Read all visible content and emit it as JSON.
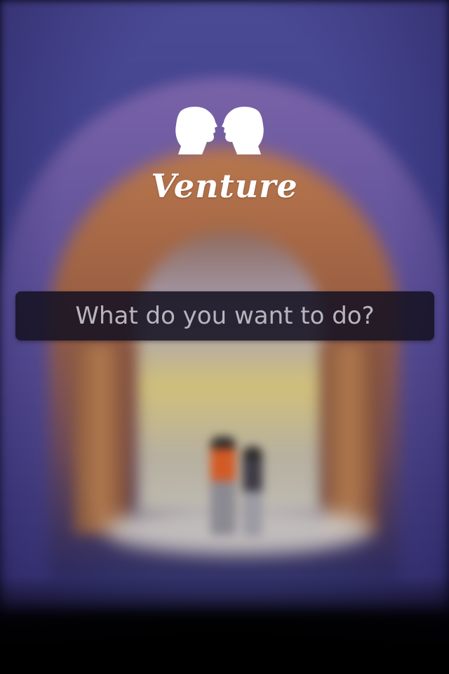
{
  "app": {
    "name": "Venture",
    "logo_icon": "two-faces-silhouette-icon"
  },
  "prompt": {
    "text": "What do you want to do?"
  },
  "colors": {
    "logo": "#ffffff",
    "prompt_bar_bg": "#16122a",
    "prompt_text": "#b8b5bd"
  }
}
